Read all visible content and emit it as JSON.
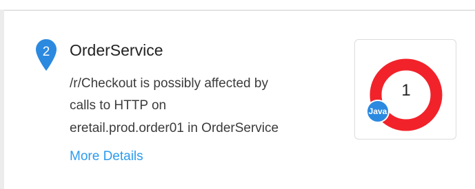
{
  "problem": {
    "index": "2",
    "service_name": "OrderService",
    "description_lines": [
      "/r/Checkout is possibly affected by",
      "calls to HTTP on",
      "eretail.prod.order01 in OrderService"
    ],
    "more_details_label": "More Details"
  },
  "card": {
    "count": "1",
    "technology_badge": "Java",
    "ring_color": "#f2222a",
    "badge_color": "#2b89e0"
  },
  "icons": {
    "marker": "map-pin-icon"
  }
}
